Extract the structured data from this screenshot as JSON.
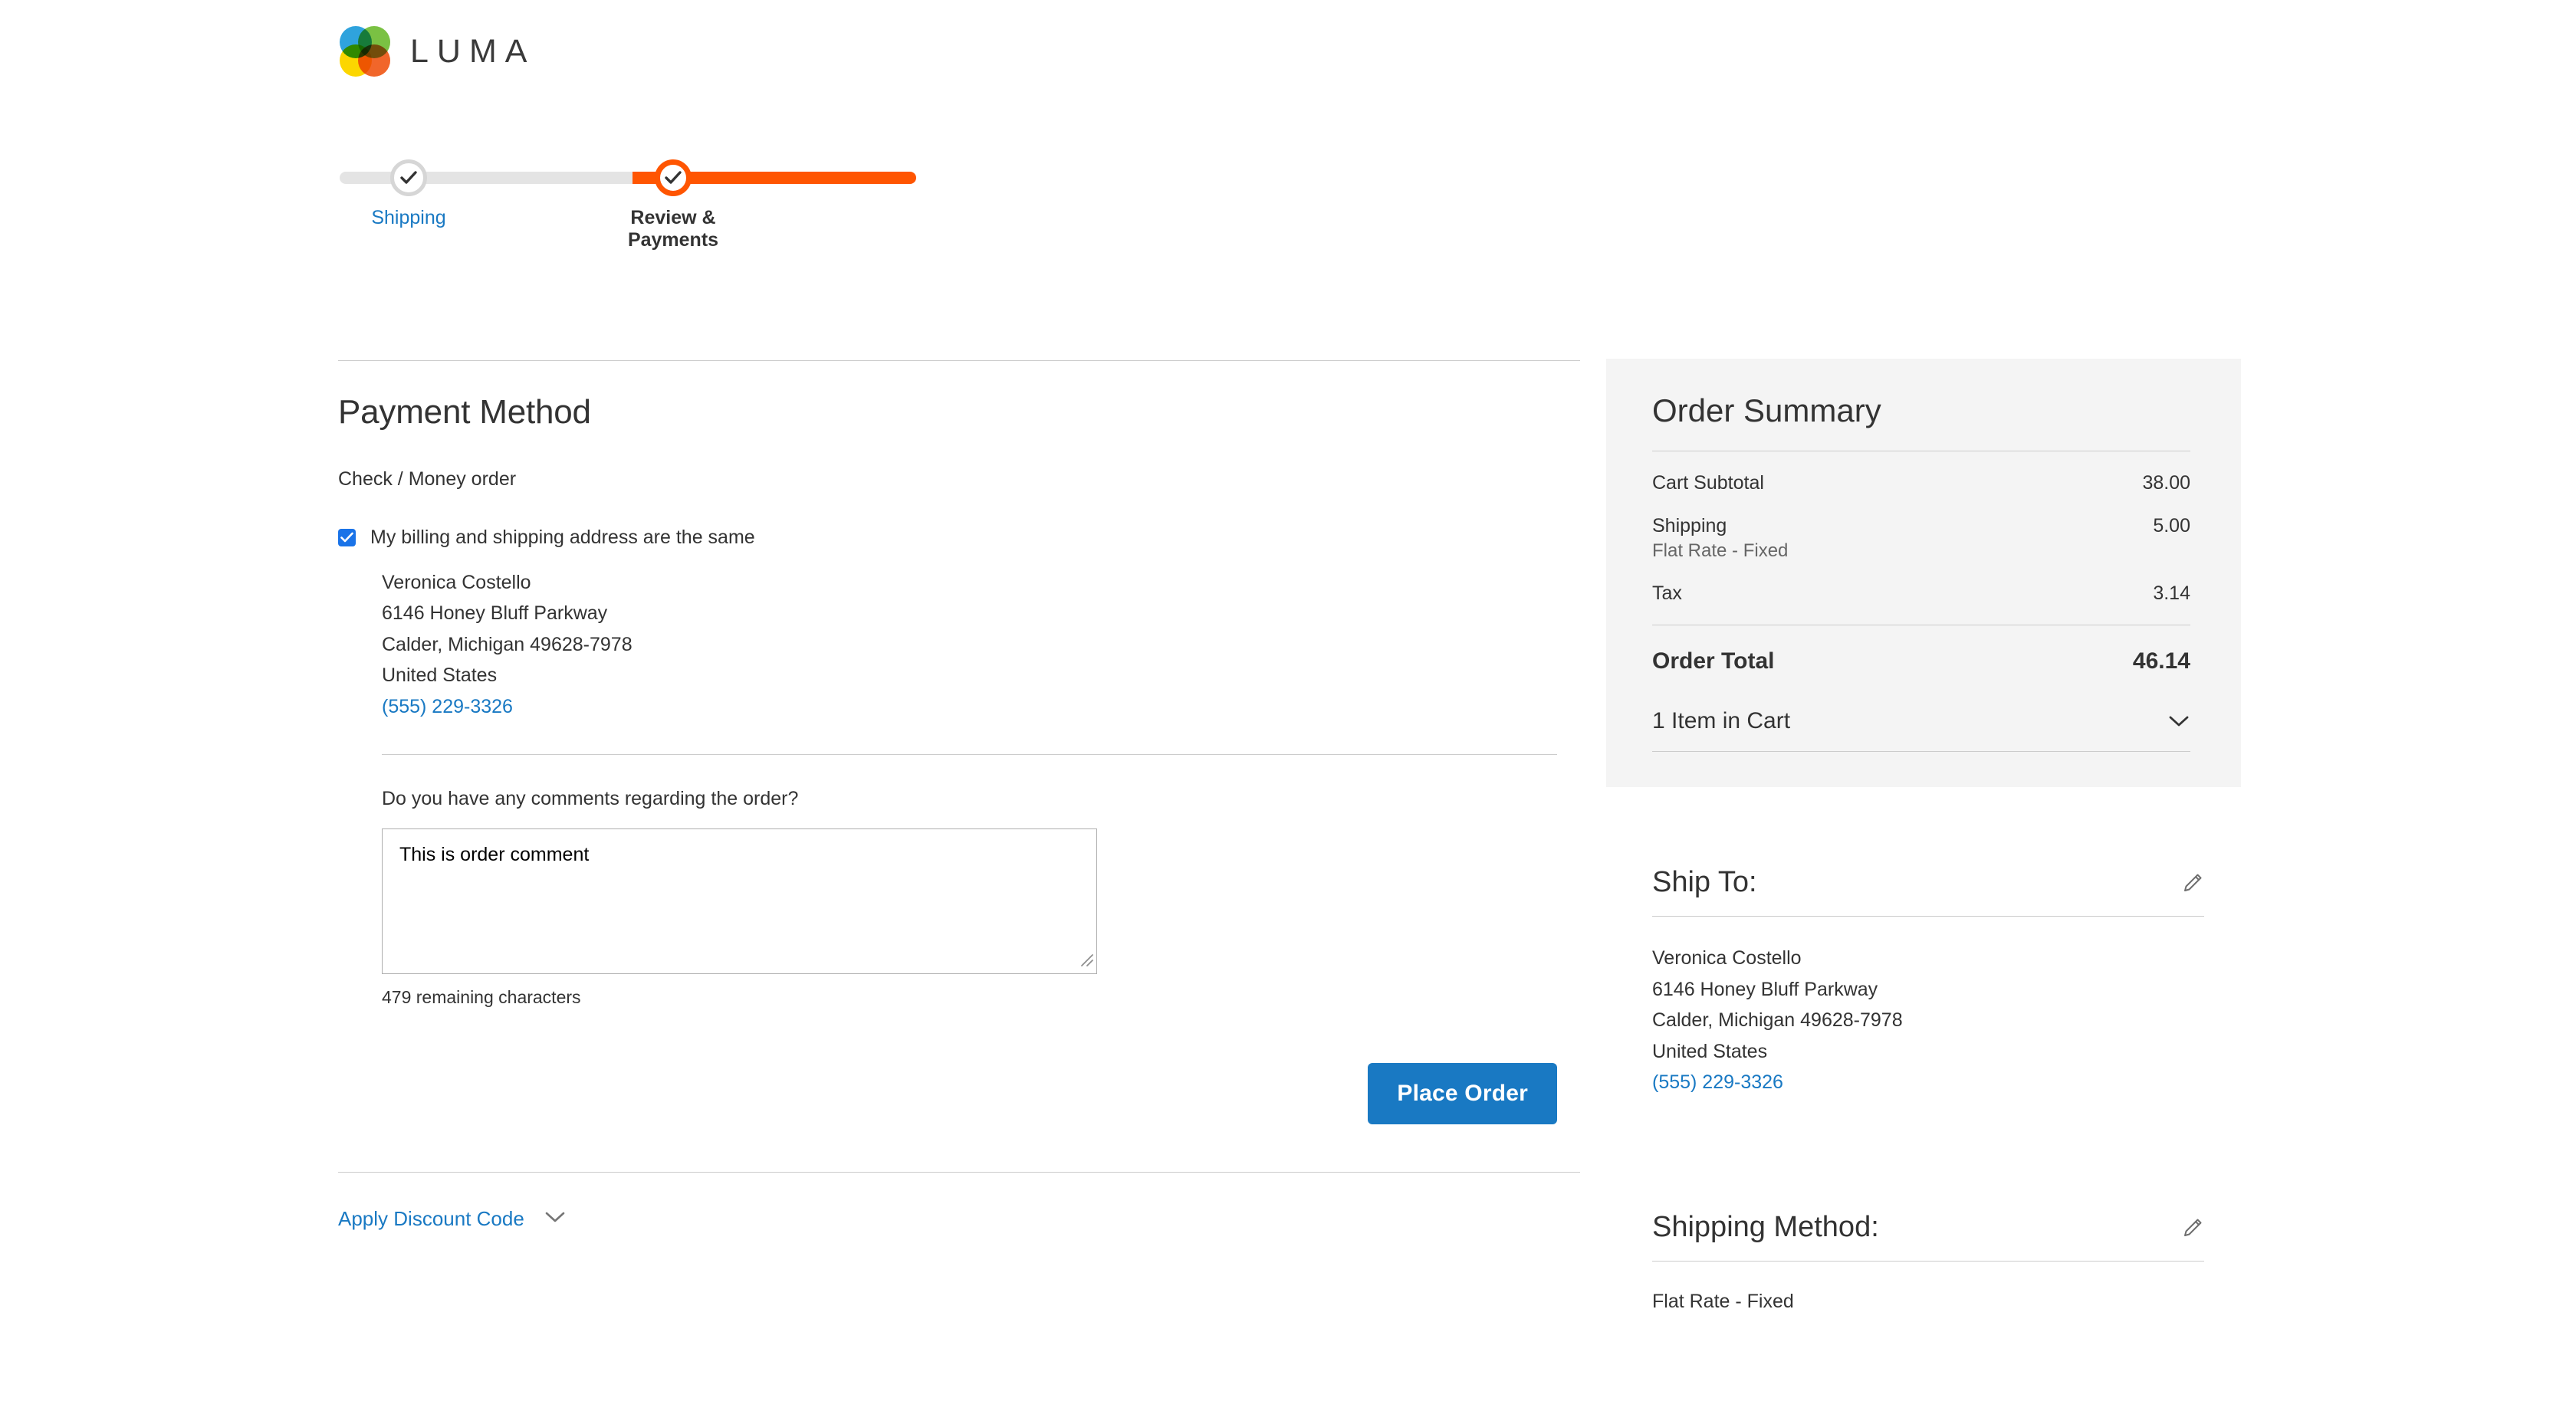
{
  "brand": {
    "name": "LUMA",
    "logo_colors": {
      "blue": "#2fa3dd",
      "green": "#7ac143",
      "yellow": "#fcd600",
      "orange": "#f1662a"
    }
  },
  "progress": {
    "steps": [
      {
        "label": "Shipping",
        "state": "complete",
        "icon": "check-icon",
        "color": "#1979c3"
      },
      {
        "label": "Review & Payments",
        "state": "active",
        "icon": "check-icon",
        "color": "#333333"
      }
    ],
    "active_color": "#ff5501",
    "track_color": "#e4e4e4"
  },
  "payment": {
    "heading": "Payment Method",
    "method_name": "Check / Money order",
    "same_address_checkbox": {
      "label": "My billing and shipping address are the same",
      "checked": true,
      "color": "#1a73e8"
    },
    "billing_address": {
      "name": "Veronica Costello",
      "street": "6146 Honey Bluff Parkway",
      "city_state_zip": "Calder, Michigan 49628-7978",
      "country": "United States",
      "phone": "(555) 229-3326"
    },
    "comments": {
      "label": "Do you have any comments regarding the order?",
      "value": "This is order comment",
      "placeholder": "",
      "remaining": "479 remaining characters"
    },
    "place_order_label": "Place Order",
    "place_order_color": "#1979c3"
  },
  "discount": {
    "label": "Apply Discount Code",
    "icon": "chevron-down-icon",
    "expanded": false
  },
  "order_summary": {
    "title": "Order Summary",
    "rows": [
      {
        "label": "Cart Subtotal",
        "value": "38.00",
        "sub": null
      },
      {
        "label": "Shipping",
        "value": "5.00",
        "sub": "Flat Rate - Fixed"
      },
      {
        "label": "Tax",
        "value": "3.14",
        "sub": null
      }
    ],
    "total": {
      "label": "Order Total",
      "value": "46.14"
    },
    "items_in_cart": {
      "label": "1 Item in Cart",
      "icon": "chevron-down-icon",
      "expanded": false
    },
    "panel_background": "#f4f4f4"
  },
  "ship_to": {
    "title": "Ship To:",
    "edit_icon": "pencil-icon",
    "name": "Veronica Costello",
    "street": "6146 Honey Bluff Parkway",
    "city_state_zip": "Calder, Michigan 49628-7978",
    "country": "United States",
    "phone": "(555) 229-3326"
  },
  "shipping_method": {
    "title": "Shipping Method:",
    "edit_icon": "pencil-icon",
    "value": "Flat Rate - Fixed"
  }
}
